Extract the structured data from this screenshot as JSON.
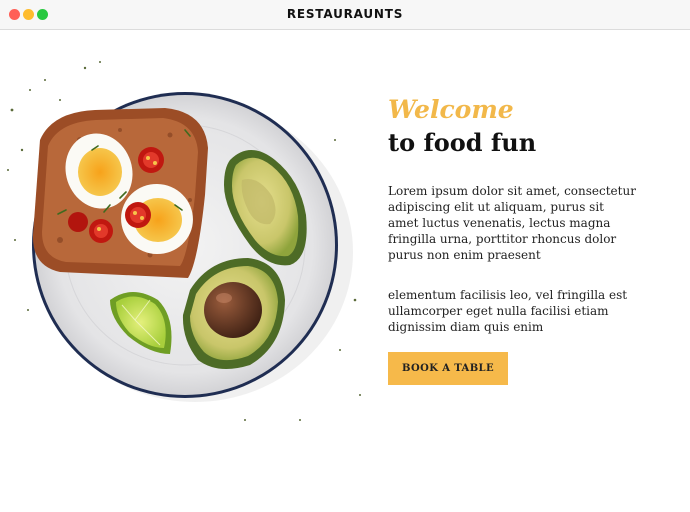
{
  "window": {
    "title": "RESTAURAUNTS",
    "controls": [
      "close",
      "minimize",
      "maximize"
    ]
  },
  "hero": {
    "welcome": "Welcome",
    "headline": "to food fun",
    "paragraph_1": "Lorem ipsum dolor sit amet, consectetur adipiscing elit ut aliquam, purus sit amet luctus venenatis, lectus magna fringilla urna, porttitor rhoncus dolor purus non enim praesent",
    "paragraph_2": "elementum facilisis leo, vel fringilla est ullamcorper eget nulla facilisi etiam dignissim diam quis enim",
    "cta_label": "BOOK A TABLE"
  },
  "colors": {
    "accent": "#f2b84a",
    "button": "#f6b94a",
    "heading": "#111111"
  },
  "image": {
    "semantic": "plate with toast, eggs, tomatoes, avocado and lime"
  }
}
